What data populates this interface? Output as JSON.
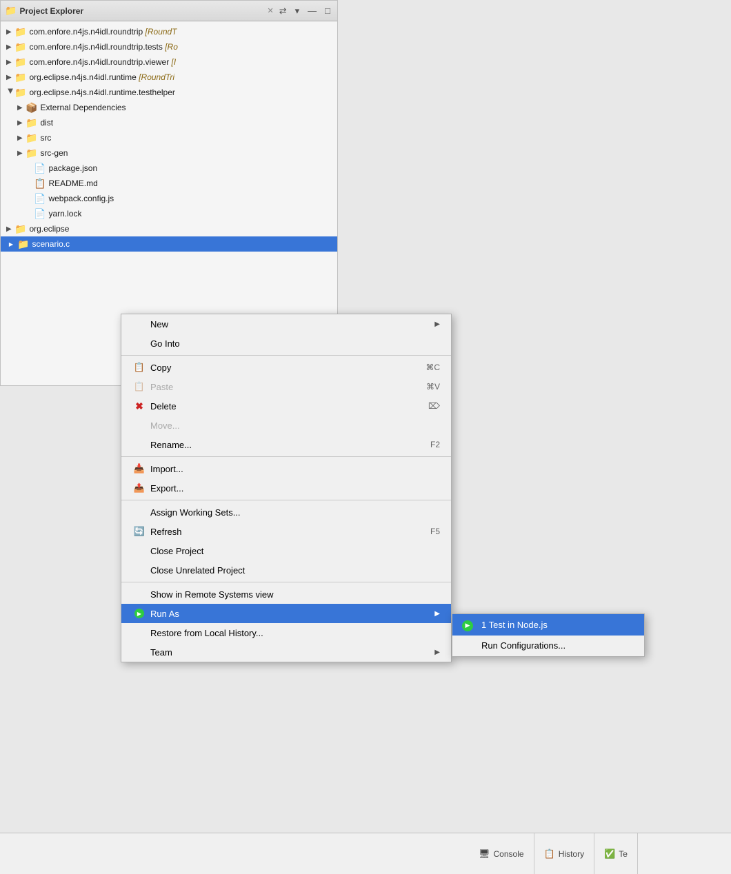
{
  "panel": {
    "title": "Project Explorer",
    "close_icon": "✕",
    "sync_icon": "⇄",
    "menu_icon": "▾",
    "minimize_icon": "—",
    "maximize_icon": "□"
  },
  "tree": {
    "items": [
      {
        "id": 1,
        "indent": 0,
        "expanded": false,
        "icon": "📁",
        "label": "com.enfore.n4js.n4idl.roundtrip",
        "bracket": "[RoundT",
        "selected": false
      },
      {
        "id": 2,
        "indent": 0,
        "expanded": false,
        "icon": "📁",
        "label": "com.enfore.n4js.n4idl.roundtrip.tests",
        "bracket": "[Ro",
        "selected": false
      },
      {
        "id": 3,
        "indent": 0,
        "expanded": false,
        "icon": "📁",
        "label": "com.enfore.n4js.n4idl.roundtrip.viewer",
        "bracket": "[I",
        "selected": false
      },
      {
        "id": 4,
        "indent": 0,
        "expanded": false,
        "icon": "📁",
        "label": "org.eclipse.n4js.n4idl.runtime",
        "bracket": "[RoundTri",
        "selected": false
      },
      {
        "id": 5,
        "indent": 0,
        "expanded": true,
        "icon": "📁",
        "label": "org.eclipse.n4js.n4idl.runtime.testhelper",
        "bracket": "",
        "selected": false
      },
      {
        "id": 6,
        "indent": 1,
        "expanded": false,
        "icon": "📦",
        "label": "External Dependencies",
        "bracket": "",
        "selected": false
      },
      {
        "id": 7,
        "indent": 1,
        "expanded": false,
        "icon": "📁",
        "label": "dist",
        "bracket": "",
        "selected": false
      },
      {
        "id": 8,
        "indent": 1,
        "expanded": false,
        "icon": "📁",
        "label": "src",
        "bracket": "",
        "selected": false
      },
      {
        "id": 9,
        "indent": 1,
        "expanded": false,
        "icon": "📁",
        "label": "src-gen",
        "bracket": "",
        "selected": false
      },
      {
        "id": 10,
        "indent": 1,
        "expanded": false,
        "icon": "📄",
        "label": "package.json",
        "bracket": "",
        "selected": false
      },
      {
        "id": 11,
        "indent": 1,
        "expanded": false,
        "icon": "📋",
        "label": "README.md",
        "bracket": "",
        "selected": false
      },
      {
        "id": 12,
        "indent": 1,
        "expanded": false,
        "icon": "📄",
        "label": "webpack.config.js",
        "bracket": "",
        "selected": false
      },
      {
        "id": 13,
        "indent": 1,
        "expanded": false,
        "icon": "📄",
        "label": "yarn.lock",
        "bracket": "",
        "selected": false
      },
      {
        "id": 14,
        "indent": 0,
        "expanded": false,
        "icon": "📁",
        "label": "org.eclipse",
        "bracket": "",
        "selected": false
      },
      {
        "id": 15,
        "indent": 0,
        "expanded": false,
        "icon": "📁",
        "label": "scenario.c",
        "bracket": "",
        "selected": true
      }
    ]
  },
  "context_menu": {
    "items": [
      {
        "id": "new",
        "icon": "",
        "label": "New",
        "shortcut": "",
        "has_arrow": true,
        "separator_after": false,
        "disabled": false
      },
      {
        "id": "go_into",
        "icon": "",
        "label": "Go Into",
        "shortcut": "",
        "has_arrow": false,
        "separator_after": true,
        "disabled": false
      },
      {
        "id": "copy",
        "icon": "📋",
        "label": "Copy",
        "shortcut": "⌘C",
        "has_arrow": false,
        "separator_after": false,
        "disabled": false
      },
      {
        "id": "paste",
        "icon": "📋",
        "label": "Paste",
        "shortcut": "⌘V",
        "has_arrow": false,
        "separator_after": false,
        "disabled": true
      },
      {
        "id": "delete",
        "icon": "❌",
        "label": "Delete",
        "shortcut": "⌦",
        "has_arrow": false,
        "separator_after": false,
        "disabled": false
      },
      {
        "id": "move",
        "icon": "",
        "label": "Move...",
        "shortcut": "",
        "has_arrow": false,
        "separator_after": false,
        "disabled": true
      },
      {
        "id": "rename",
        "icon": "",
        "label": "Rename...",
        "shortcut": "F2",
        "has_arrow": false,
        "separator_after": true,
        "disabled": false
      },
      {
        "id": "import",
        "icon": "📥",
        "label": "Import...",
        "shortcut": "",
        "has_arrow": false,
        "separator_after": false,
        "disabled": false
      },
      {
        "id": "export",
        "icon": "📤",
        "label": "Export...",
        "shortcut": "",
        "has_arrow": false,
        "separator_after": true,
        "disabled": false
      },
      {
        "id": "worksets",
        "icon": "",
        "label": "Assign Working Sets...",
        "shortcut": "",
        "has_arrow": false,
        "separator_after": false,
        "disabled": false
      },
      {
        "id": "refresh",
        "icon": "🔄",
        "label": "Refresh",
        "shortcut": "F5",
        "has_arrow": false,
        "separator_after": false,
        "disabled": false
      },
      {
        "id": "close",
        "icon": "",
        "label": "Close Project",
        "shortcut": "",
        "has_arrow": false,
        "separator_after": false,
        "disabled": false
      },
      {
        "id": "close_unrelated",
        "icon": "",
        "label": "Close Unrelated Project",
        "shortcut": "",
        "has_arrow": false,
        "separator_after": true,
        "disabled": false
      },
      {
        "id": "remote",
        "icon": "",
        "label": "Show in Remote Systems view",
        "shortcut": "",
        "has_arrow": false,
        "separator_after": false,
        "disabled": false
      },
      {
        "id": "run_as",
        "icon": "",
        "label": "Run As",
        "shortcut": "",
        "has_arrow": true,
        "separator_after": false,
        "disabled": false,
        "active": true
      },
      {
        "id": "restore",
        "icon": "",
        "label": "Restore from Local History...",
        "shortcut": "",
        "has_arrow": false,
        "separator_after": false,
        "disabled": false
      },
      {
        "id": "team",
        "icon": "",
        "label": "Team",
        "shortcut": "",
        "has_arrow": true,
        "separator_after": false,
        "disabled": false
      }
    ]
  },
  "submenu": {
    "items": [
      {
        "id": "run1",
        "icon": "▶",
        "label": "1 Test in Node.js",
        "highlighted": true
      },
      {
        "id": "run_configs",
        "icon": "",
        "label": "Run Configurations...",
        "highlighted": false
      }
    ]
  },
  "bottom_tabs": {
    "tabs": [
      {
        "id": "console",
        "icon": "🖥",
        "label": "Console"
      },
      {
        "id": "history",
        "icon": "📋",
        "label": "History"
      },
      {
        "id": "te",
        "icon": "✅",
        "label": "Te"
      }
    ]
  }
}
